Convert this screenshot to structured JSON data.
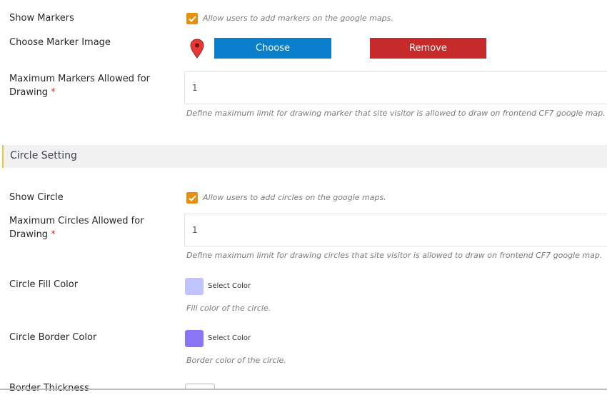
{
  "markers": {
    "show_markers_label": "Show Markers",
    "show_markers_hint": "Allow users to add markers on the google maps.",
    "marker_image_label": "Choose Marker Image",
    "choose_button": "Choose",
    "remove_button": "Remove",
    "max_markers_label_line1": "Maximum Markers Allowed for",
    "max_markers_label_line2": "Drawing",
    "required_mark": "*",
    "max_markers_value": "1",
    "max_markers_hint": "Define maximum limit for drawing marker that site visitor is allowed to draw on frontend CF7 google map."
  },
  "circle_section": {
    "title": "Circle Setting"
  },
  "circle": {
    "show_circle_label": "Show Circle",
    "show_circle_hint": "Allow users to add circles on the google maps.",
    "max_circles_label_line1": "Maximum Circles Allowed for",
    "max_circles_label_line2": "Drawing",
    "required_mark": "*",
    "max_circles_value": "1",
    "max_circles_hint": "Define maximum limit for drawing circles that site visitor is allowed to draw on frontend CF7 google map.",
    "fill_color_label": "Circle Fill Color",
    "fill_color_button": "Select Color",
    "fill_color_value": "#bfc3ff",
    "fill_color_hint": "Fill color of the circle.",
    "border_color_label": "Circle Border Color",
    "border_color_button": "Select Color",
    "border_color_value": "#8a76f5",
    "border_color_hint": "Border color of the circle.",
    "border_thickness_label": "Border Thickness"
  },
  "colors": {
    "checkbox": "#e8900c",
    "choose_button": "#0a7fcc",
    "remove_button": "#c62a2a",
    "required": "#dc3232",
    "section_accent": "#f0c33c",
    "map_pin": "#e53935"
  },
  "icons": {
    "checkmark": "check-icon",
    "marker_preview": "map-pin-icon"
  }
}
